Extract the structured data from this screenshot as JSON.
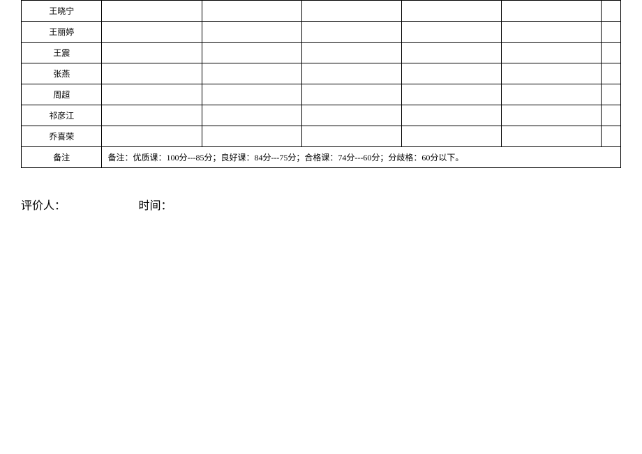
{
  "rows": {
    "r0": "王晓宁",
    "r1": "王丽婷",
    "r2": "王震",
    "r3": "张燕",
    "r4": "周超",
    "r5": "祁彦江",
    "r6": "乔喜荣",
    "note_label": "备注"
  },
  "note_content": "备注：优质课：100分---85分；良好课：84分---75分；合格课：74分---60分；分歧格：60分以下。",
  "footer": {
    "evaluator_label": "评价人：",
    "time_label": "时间："
  }
}
